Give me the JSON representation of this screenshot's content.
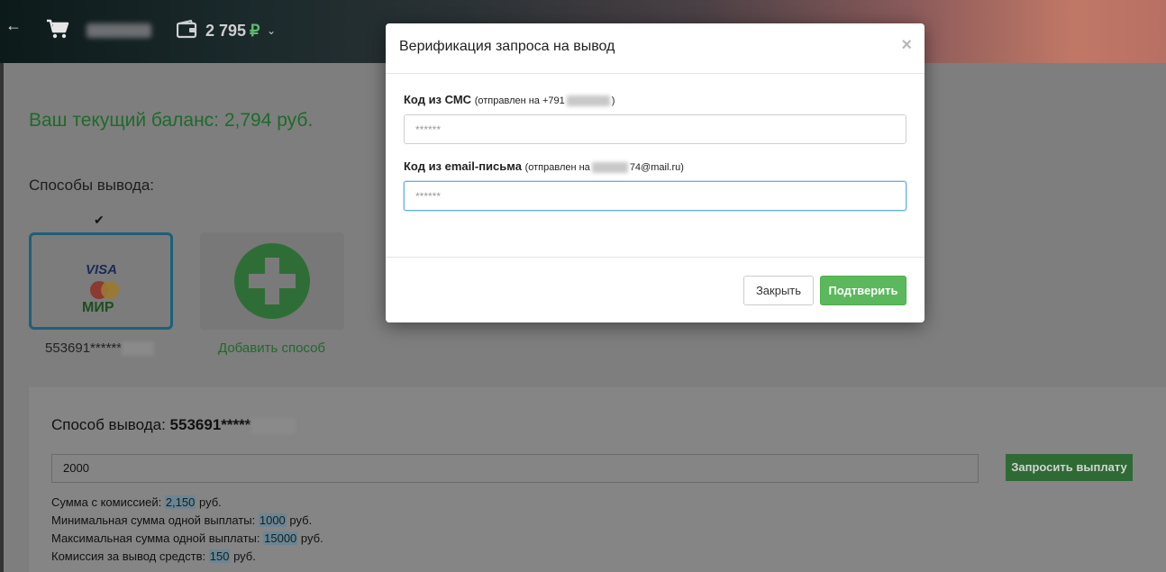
{
  "header": {
    "back_icon": "arrow-left-icon",
    "cart_icon": "cart-icon",
    "wallet_icon": "wallet-icon",
    "balance_amount": "2 795",
    "balance_currency": "₽",
    "balance_chevron": "⌄"
  },
  "page": {
    "current_balance": "Ваш текущий баланс: 2,794 руб.",
    "methods_title": "Способы вывода:",
    "selected_check": "✔",
    "card": {
      "brand_visa": "VISA",
      "brand_mir": "МИР",
      "number": "553691******"
    },
    "add_method_label": "Добавить способ",
    "method_panel": {
      "title_prefix": "Способ вывода:",
      "title_value": "553691*****",
      "amount_value": "2000",
      "request_button": "Запросить выплату",
      "fee_sum_label": "Сумма с комиссией:",
      "fee_sum_value": "2,150",
      "fee_sum_unit": "руб.",
      "min_label": "Минимальная сумма одной выплаты:",
      "min_value": "1000",
      "min_unit": "руб.",
      "max_label": "Максимальная сумма одной выплаты:",
      "max_value": "15000",
      "max_unit": "руб.",
      "commission_label": "Комиссия за вывод средств:",
      "commission_value": "150",
      "commission_unit": "руб."
    }
  },
  "modal": {
    "title": "Верификация запроса на вывод",
    "close_symbol": "×",
    "sms": {
      "label": "Код из СМС",
      "note_prefix": "(отправлен на +791",
      "note_suffix": ")",
      "placeholder": "******"
    },
    "email": {
      "label": "Код из email-письма",
      "note_prefix": "(отправлен на",
      "note_suffix": "74@mail.ru)",
      "placeholder": "******"
    },
    "close_button": "Закрыть",
    "confirm_button": "Подтверить"
  },
  "colors": {
    "accent_green": "#5cb85c",
    "balance_green": "#1d6b2a",
    "focus_blue": "#66afe9"
  }
}
